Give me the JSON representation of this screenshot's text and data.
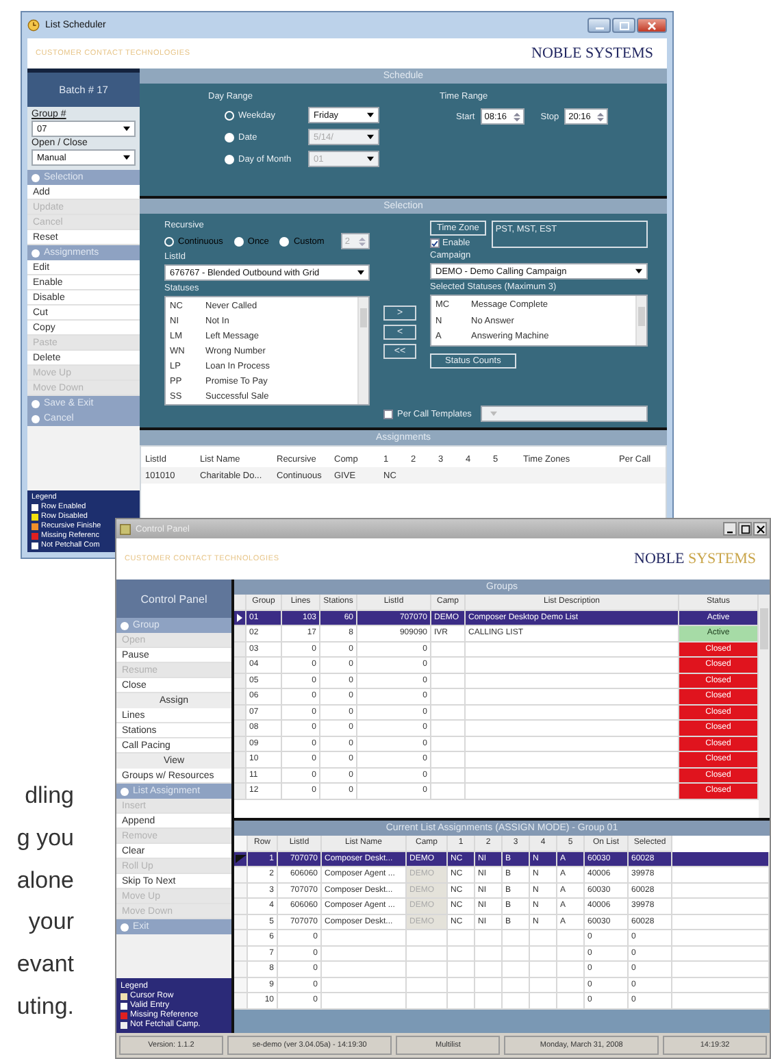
{
  "side_text": [
    "dling",
    "g you",
    "alone",
    "your",
    "evant",
    "uting."
  ],
  "scheduler": {
    "title": "List Scheduler",
    "tagline": "CUSTOMER CONTACT TECHNOLOGIES",
    "logo": [
      "NOBLE",
      "SYSTEMS"
    ],
    "sidebar": {
      "batch": "Batch # 17",
      "group_label": "Group #",
      "group_value": "07",
      "open_close_label": "Open / Close",
      "open_close_value": "Manual",
      "items": [
        {
          "kind": "section",
          "label": "Selection"
        },
        {
          "kind": "item",
          "label": "Add",
          "disabled": false
        },
        {
          "kind": "item",
          "label": "Update",
          "disabled": true
        },
        {
          "kind": "item",
          "label": "Cancel",
          "disabled": true
        },
        {
          "kind": "item",
          "label": "Reset",
          "disabled": false
        },
        {
          "kind": "section",
          "label": "Assignments"
        },
        {
          "kind": "item",
          "label": "Edit",
          "disabled": false
        },
        {
          "kind": "item",
          "label": "Enable",
          "disabled": false
        },
        {
          "kind": "item",
          "label": "Disable",
          "disabled": false
        },
        {
          "kind": "item",
          "label": "Cut",
          "disabled": false
        },
        {
          "kind": "item",
          "label": "Copy",
          "disabled": false
        },
        {
          "kind": "item",
          "label": "Paste",
          "disabled": true
        },
        {
          "kind": "item",
          "label": "Delete",
          "disabled": false
        },
        {
          "kind": "item",
          "label": "Move Up",
          "disabled": true
        },
        {
          "kind": "item",
          "label": "Move Down",
          "disabled": true
        },
        {
          "kind": "section",
          "label": "Save & Exit"
        },
        {
          "kind": "section",
          "label": "Cancel"
        }
      ],
      "legend": {
        "title": "Legend",
        "items": [
          {
            "label": "Row Enabled",
            "color": "#ffffff"
          },
          {
            "label": "Row Disabled",
            "color": "#f2e010"
          },
          {
            "label": "Recursive Finishe",
            "color": "#f0902a"
          },
          {
            "label": "Missing Referenc",
            "color": "#e02020"
          },
          {
            "label": "Not Petchall Com",
            "color": "#ffffff"
          }
        ]
      }
    },
    "schedule": {
      "header": "Schedule",
      "day_range_label": "Day Range",
      "day_options": [
        {
          "label": "Weekday",
          "selected": true,
          "value": "Friday",
          "disabled": false
        },
        {
          "label": "Date",
          "selected": false,
          "value": "5/14/",
          "disabled": true
        },
        {
          "label": "Day of Month",
          "selected": false,
          "value": "01",
          "disabled": true
        }
      ],
      "time_range_label": "Time Range",
      "start_label": "Start",
      "start": "08:16",
      "stop_label": "Stop",
      "stop": "20:16"
    },
    "selection": {
      "header": "Selection",
      "recursive_label": "Recursive",
      "recursive_options": [
        {
          "label": "Continuous",
          "selected": true
        },
        {
          "label": "Once",
          "selected": false
        },
        {
          "label": "Custom",
          "selected": false
        }
      ],
      "custom_count": "2",
      "listid_label": "ListId",
      "listid": "676767 - Blended Outbound with Grid",
      "statuses_label": "Statuses",
      "statuses": [
        {
          "code": "NC",
          "name": "Never Called"
        },
        {
          "code": "NI",
          "name": "Not In"
        },
        {
          "code": "LM",
          "name": "Left Message"
        },
        {
          "code": "WN",
          "name": "Wrong Number"
        },
        {
          "code": "LP",
          "name": "Loan In Process"
        },
        {
          "code": "PP",
          "name": "Promise To Pay"
        },
        {
          "code": "SS",
          "name": "Successful Sale"
        }
      ],
      "move_buttons": [
        ">",
        "<",
        "<<"
      ],
      "time_zone_button": "Time Zone",
      "time_zones": "PST, MST, EST",
      "enable_label": "Enable",
      "enable_checked": true,
      "campaign_label": "Campaign",
      "campaign": "DEMO - Demo Calling Campaign",
      "selected_statuses_label": "Selected Statuses (Maximum 3)",
      "selected_statuses": [
        {
          "code": "MC",
          "name": "Message Complete"
        },
        {
          "code": "N",
          "name": "No Answer"
        },
        {
          "code": "A",
          "name": "Answering Machine"
        }
      ],
      "status_counts_button": "Status Counts",
      "per_call_label": "Per Call Templates",
      "per_call_checked": false
    },
    "assignments": {
      "header": "Assignments",
      "columns": [
        "ListId",
        "List Name",
        "Recursive",
        "Comp",
        "1",
        "2",
        "3",
        "4",
        "5",
        "Time Zones",
        "Per Call"
      ],
      "rows": [
        [
          "101010",
          "Charitable Do...",
          "Continuous",
          "GIVE",
          "NC"
        ]
      ]
    }
  },
  "control_panel": {
    "title": "Control Panel",
    "tagline": "CUSTOMER CONTACT TECHNOLOGIES",
    "logo": [
      "NOBLE",
      "SYSTEMS"
    ],
    "sidebar": {
      "header": "Control Panel",
      "items": [
        {
          "kind": "section",
          "label": "Group"
        },
        {
          "kind": "item",
          "label": "Open",
          "disabled": true
        },
        {
          "kind": "item",
          "label": "Pause",
          "disabled": false
        },
        {
          "kind": "item",
          "label": "Resume",
          "disabled": true
        },
        {
          "kind": "item",
          "label": "Close",
          "disabled": false
        },
        {
          "kind": "heading",
          "label": "Assign"
        },
        {
          "kind": "item",
          "label": "Lines",
          "disabled": false
        },
        {
          "kind": "item",
          "label": "Stations",
          "disabled": false
        },
        {
          "kind": "item",
          "label": "Call Pacing",
          "disabled": false
        },
        {
          "kind": "heading",
          "label": "View"
        },
        {
          "kind": "item",
          "label": "Groups w/ Resources",
          "disabled": false
        },
        {
          "kind": "section",
          "label": "List Assignment"
        },
        {
          "kind": "item",
          "label": "Insert",
          "disabled": true
        },
        {
          "kind": "item",
          "label": "Append",
          "disabled": false
        },
        {
          "kind": "item",
          "label": "Remove",
          "disabled": true
        },
        {
          "kind": "item",
          "label": "Clear",
          "disabled": false
        },
        {
          "kind": "item",
          "label": "Roll Up",
          "disabled": true
        },
        {
          "kind": "item",
          "label": "Skip To Next",
          "disabled": false
        },
        {
          "kind": "item",
          "label": "Move Up",
          "disabled": true
        },
        {
          "kind": "item",
          "label": "Move Down",
          "disabled": true
        },
        {
          "kind": "section",
          "label": "Exit"
        }
      ],
      "legend": {
        "title": "Legend",
        "items": [
          {
            "label": "Cursor Row",
            "color": "#f0e0b0"
          },
          {
            "label": "Valid Entry",
            "color": "#ffffff"
          },
          {
            "label": "Missing Reference",
            "color": "#e02020"
          },
          {
            "label": "Not Fetchall Camp.",
            "color": "#eeeeee"
          }
        ]
      }
    },
    "groups": {
      "header": "Groups",
      "columns": [
        "Group",
        "Lines",
        "Stations",
        "ListId",
        "Camp",
        "List Description",
        "Status"
      ],
      "rows": [
        {
          "group": "01",
          "lines": "103",
          "stations": "60",
          "listid": "707070",
          "camp": "DEMO",
          "description": "Composer Desktop Demo List",
          "status": "Active",
          "color": "#3b2c86",
          "selected": true
        },
        {
          "group": "02",
          "lines": "17",
          "stations": "8",
          "listid": "909090",
          "camp": "IVR",
          "description": "CALLING LIST",
          "status": "Active",
          "color": "#a6dba6",
          "selected": false
        },
        {
          "group": "03",
          "lines": "0",
          "stations": "0",
          "listid": "0",
          "status": "Closed",
          "color": "#e0141e",
          "selected": false
        },
        {
          "group": "04",
          "lines": "0",
          "stations": "0",
          "listid": "0",
          "status": "Closed",
          "color": "#e0141e",
          "selected": false
        },
        {
          "group": "05",
          "lines": "0",
          "stations": "0",
          "listid": "0",
          "status": "Closed",
          "color": "#e0141e",
          "selected": false
        },
        {
          "group": "06",
          "lines": "0",
          "stations": "0",
          "listid": "0",
          "status": "Closed",
          "color": "#e0141e",
          "selected": false
        },
        {
          "group": "07",
          "lines": "0",
          "stations": "0",
          "listid": "0",
          "status": "Closed",
          "color": "#e0141e",
          "selected": false
        },
        {
          "group": "08",
          "lines": "0",
          "stations": "0",
          "listid": "0",
          "status": "Closed",
          "color": "#e0141e",
          "selected": false
        },
        {
          "group": "09",
          "lines": "0",
          "stations": "0",
          "listid": "0",
          "status": "Closed",
          "color": "#e0141e",
          "selected": false
        },
        {
          "group": "10",
          "lines": "0",
          "stations": "0",
          "listid": "0",
          "status": "Closed",
          "color": "#e0141e",
          "selected": false
        },
        {
          "group": "11",
          "lines": "0",
          "stations": "0",
          "listid": "0",
          "status": "Closed",
          "color": "#e0141e",
          "selected": false
        },
        {
          "group": "12",
          "lines": "0",
          "stations": "0",
          "listid": "0",
          "status": "Closed",
          "color": "#e0141e",
          "selected": false
        }
      ]
    },
    "assignments": {
      "header": "Current List Assignments (ASSIGN MODE) - Group 01",
      "columns": [
        "Row",
        "ListId",
        "List Name",
        "Camp",
        "1",
        "2",
        "3",
        "4",
        "5",
        "On List",
        "Selected"
      ],
      "rows": [
        {
          "row": "1",
          "listid": "707070",
          "list_name": "Composer Deskt...",
          "camp": "DEMO",
          "codes": [
            "NC",
            "NI",
            "B",
            "N",
            "A"
          ],
          "on_list": "60030",
          "selected_count": "60028",
          "selected": true
        },
        {
          "row": "2",
          "listid": "606060",
          "list_name": "Composer Agent ...",
          "camp": "DEMO",
          "codes": [
            "NC",
            "NI",
            "B",
            "N",
            "A"
          ],
          "on_list": "40006",
          "selected_count": "39978",
          "selected": false
        },
        {
          "row": "3",
          "listid": "707070",
          "list_name": "Composer Deskt...",
          "camp": "DEMO",
          "codes": [
            "NC",
            "NI",
            "B",
            "N",
            "A"
          ],
          "on_list": "60030",
          "selected_count": "60028",
          "selected": false
        },
        {
          "row": "4",
          "listid": "606060",
          "list_name": "Composer Agent ...",
          "camp": "DEMO",
          "codes": [
            "NC",
            "NI",
            "B",
            "N",
            "A"
          ],
          "on_list": "40006",
          "selected_count": "39978",
          "selected": false
        },
        {
          "row": "5",
          "listid": "707070",
          "list_name": "Composer Deskt...",
          "camp": "DEMO",
          "codes": [
            "NC",
            "NI",
            "B",
            "N",
            "A"
          ],
          "on_list": "60030",
          "selected_count": "60028",
          "selected": false
        },
        {
          "row": "6",
          "listid": "0",
          "on_list": "0",
          "selected_count": "0",
          "selected": false
        },
        {
          "row": "7",
          "listid": "0",
          "on_list": "0",
          "selected_count": "0",
          "selected": false
        },
        {
          "row": "8",
          "listid": "0",
          "on_list": "0",
          "selected_count": "0",
          "selected": false
        },
        {
          "row": "9",
          "listid": "0",
          "on_list": "0",
          "selected_count": "0",
          "selected": false
        },
        {
          "row": "10",
          "listid": "0",
          "on_list": "0",
          "selected_count": "0",
          "selected": false
        }
      ]
    },
    "status_bar": [
      "Version: 1.1.2",
      "se-demo (ver 3.04.05a) - 14:19:30",
      "Multilist",
      "Monday, March 31, 2008",
      "14:19:32"
    ]
  }
}
